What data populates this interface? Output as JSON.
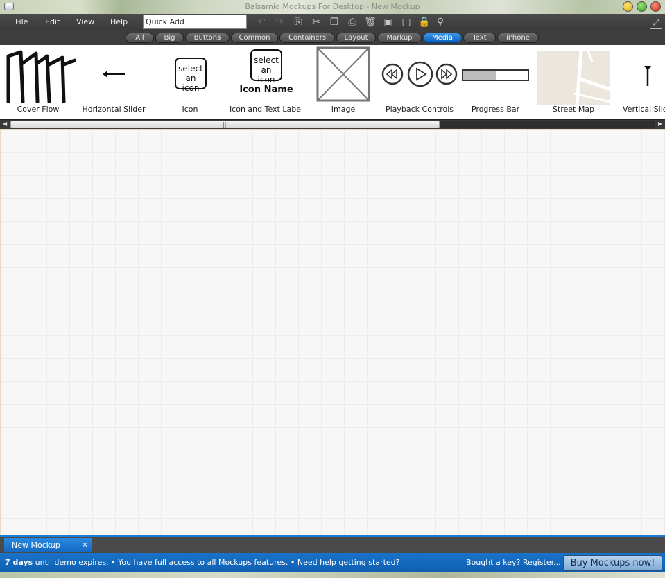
{
  "window": {
    "title": "Balsamiq Mockups For Desktop - New Mockup"
  },
  "menu": {
    "items": [
      "File",
      "Edit",
      "View",
      "Help"
    ]
  },
  "quick_add": {
    "value": "Quick Add"
  },
  "toolbar_icons": [
    "undo-icon",
    "redo-icon",
    "copy-icon",
    "cut-icon",
    "duplicate-icon",
    "paste-icon",
    "delete-icon",
    "group-icon",
    "ungroup-icon",
    "lock-icon",
    "search-icon"
  ],
  "filters": {
    "items": [
      "All",
      "Big",
      "Buttons",
      "Common",
      "Containers",
      "Layout",
      "Markup",
      "Media",
      "Text",
      "iPhone"
    ],
    "active": "Media"
  },
  "library": {
    "items": [
      {
        "label": "Cover Flow"
      },
      {
        "label": "Horizontal Slider"
      },
      {
        "label": "Icon",
        "thumb_text": [
          "select",
          "an icon"
        ]
      },
      {
        "label": "Icon and Text Label",
        "thumb_text": [
          "select",
          "an icon"
        ],
        "thumb_caption": "Icon Name"
      },
      {
        "label": "Image"
      },
      {
        "label": "Playback Controls"
      },
      {
        "label": "Progress Bar",
        "progress": 0.5
      },
      {
        "label": "Street Map"
      },
      {
        "label": "Vertical Slid"
      }
    ]
  },
  "tabs": {
    "items": [
      {
        "label": "New Mockup"
      }
    ]
  },
  "status": {
    "days": "7 days",
    "text1": " until demo expires. • You have full access to all Mockups features. • ",
    "help_link": "Need help getting started?",
    "key_text": "Bought a key? ",
    "register_link": "Register...",
    "buy_button": "Buy Mockups now!"
  }
}
